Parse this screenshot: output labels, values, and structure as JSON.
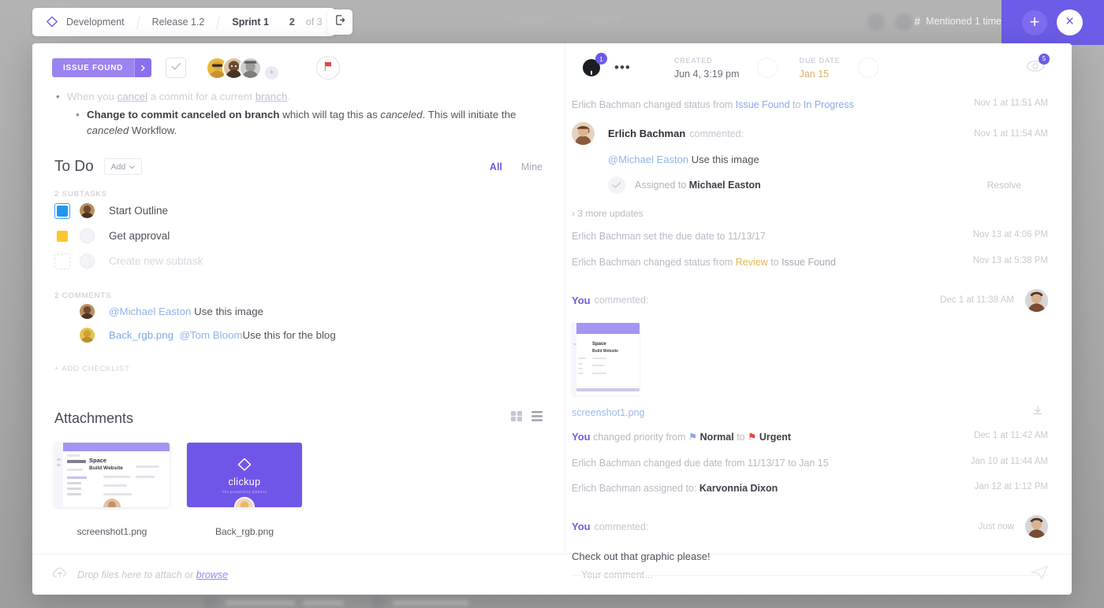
{
  "topbar": {
    "logo_icon": "clickup-diamond-icon",
    "breadcrumbs": [
      {
        "label": "Development",
        "style": "normal"
      },
      {
        "label": "Release 1.2",
        "style": "normal"
      },
      {
        "label": "Sprint 1",
        "style": "bold"
      }
    ],
    "task_index": "2",
    "task_total": "of 3",
    "export_icon": "export-icon",
    "mention_hash": "#",
    "mention_text": "Mentioned 1 time",
    "plus_label": "+",
    "close_label": "×",
    "accent": "#6c5ce7"
  },
  "task": {
    "status": "ISSUE FOUND",
    "status_arrow_icon": "chevron-right-icon",
    "complete_icon": "check-icon",
    "add_assignee_icon": "add-person-icon",
    "priority_flag_icon": "flag-icon",
    "priority_flag_color": "#e8423f",
    "github_icon": "github-icon",
    "github_badge": "1",
    "more_icon": "ellipsis-icon",
    "created_label": "CREATED",
    "created_value": "Jun 4, 3:19 pm",
    "due_label": "DUE DATE",
    "due_value": "Jan 15",
    "watch_icon": "eye-icon",
    "watch_count": "5"
  },
  "description": {
    "line1_pre": "When you ",
    "line1_link1": "cancel",
    "line1_mid": " a commit for a current ",
    "line1_link2": "branch",
    "line1_end": ".",
    "line2_bold": "Change to commit canceled on branch",
    "line2_mid": " which will tag this as ",
    "line2_it1": "canceled",
    "line2_mid2": ". This will initiate the ",
    "line2_it2": "canceled",
    "line2_end": " Workflow."
  },
  "todo": {
    "title": "To Do",
    "add_label": "Add",
    "add_caret_icon": "chevron-down-icon",
    "filter_all": "All",
    "filter_mine": "Mine",
    "subtasks_label": "2 SUBTASKS",
    "subtasks": [
      {
        "name": "Start Outline",
        "color": "#2196f3",
        "selected": true,
        "has_avatar": true
      },
      {
        "name": "Get approval",
        "color": "#ffc62b",
        "selected": false,
        "has_avatar": false
      }
    ],
    "new_subtask_placeholder": "Create new subtask",
    "comments_label": "2 COMMENTS",
    "comments": [
      {
        "mention": "@Michael Easton",
        "text": " Use this image",
        "file": ""
      },
      {
        "file": "Back_rgb.png",
        "mention": "@Tom Bloom",
        "text": "Use this for the blog"
      }
    ],
    "add_checklist": "+ ADD CHECKLIST"
  },
  "attachments": {
    "title": "Attachments",
    "view_grid_icon": "grid-view-icon",
    "view_list_icon": "list-view-icon",
    "items": [
      {
        "name": "screenshot1.png",
        "kind": "screenshot",
        "thumb_title": "Space",
        "thumb_sub": "Build Website"
      },
      {
        "name": "Back_rgb.png",
        "kind": "brand",
        "brand_name": "clickup",
        "brand_tagline": "The productivity platform"
      }
    ]
  },
  "activity": [
    {
      "type": "status",
      "actor": "Erlich Bachman",
      "verb": " changed status from ",
      "from": "Issue Found",
      "from_color": "blue",
      "mid": " to ",
      "to": "In Progress",
      "to_color": "blue",
      "time": "Nov 1 at 11:51 AM"
    },
    {
      "type": "comment",
      "author": "Erlich Bachman",
      "verb": "commented:",
      "time": "Nov 1 at 11:54 AM",
      "mention": "@Michael Easton",
      "body": " Use this image",
      "assigned_prefix": "Assigned to ",
      "assigned_to": "Michael Easton",
      "assigned_icon": "assign-check-icon",
      "resolve_label": "Resolve"
    },
    {
      "type": "more",
      "label": "3 more updates",
      "caret_icon": "chevron-right-icon"
    },
    {
      "type": "plain",
      "actor": "Erlich Bachman",
      "verb": " set the due date to 11/13/17",
      "time": "Nov 13 at 4:06 PM"
    },
    {
      "type": "status",
      "actor": "Erlich Bachman",
      "verb": " changed status from ",
      "from": "Review",
      "from_color": "yellow",
      "mid": " to ",
      "to": "Issue Found",
      "to_color": "grey",
      "time": "Nov 13 at 5:38 PM"
    },
    {
      "type": "you-comment-attach",
      "author": "You",
      "verb": "commented:",
      "time": "Dec 1 at 11:38 AM",
      "file_name": "screenshot1.png",
      "download_icon": "download-icon"
    },
    {
      "type": "priority",
      "actor": "You",
      "verb": " changed priority from ",
      "from": "Normal",
      "from_flag": "#8aa9e8",
      "mid": " to ",
      "to": "Urgent",
      "to_flag": "#e8423f",
      "time": "Dec 1 at 11:42 AM"
    },
    {
      "type": "plain",
      "actor": "Erlich Bachman",
      "verb": " changed due date from 11/13/17 to Jan 15",
      "time": "Jan 10 at 11:44 AM"
    },
    {
      "type": "assign",
      "actor": "Erlich Bachman",
      "verb": " assigned to: ",
      "target": "Karvonnia Dixon",
      "time": "Jan 12 at 1:12 PM"
    },
    {
      "type": "you-comment",
      "author": "You",
      "verb": "commented:",
      "time": "Just now",
      "body": "Check out that graphic please!"
    }
  ],
  "footer": {
    "upload_icon": "cloud-upload-icon",
    "drop_pre": "Drop files here to attach or ",
    "drop_link": "browse",
    "comment_placeholder": "Your comment...",
    "send_icon": "send-icon"
  }
}
